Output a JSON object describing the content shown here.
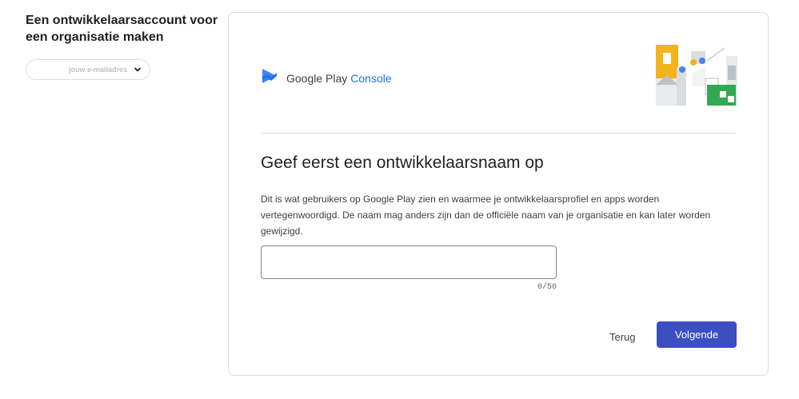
{
  "sidebar": {
    "heading": "Een ontwikkelaarsaccount voor een organisatie maken",
    "account_chip": "jouw e-mailadres",
    "chip_icon": "chevron-down-icon"
  },
  "card": {
    "brand": {
      "name": "Google Play",
      "product": "Console",
      "icon": "google-play-console-logo"
    },
    "title": "Geef eerst een ontwikkelaarsnaam op",
    "description": "Dit is wat gebruikers op Google Play zien en waarmee je ontwikkelaarsprofiel en apps worden vertegenwoordigd. De naam mag anders zijn dan de officiële naam van je organisatie en kan later worden gewijzigd.",
    "input": {
      "value": "",
      "placeholder": ""
    },
    "counter": "0/50",
    "back_label": "Terug",
    "next_label": "Volgende"
  },
  "colors": {
    "primary_button": "#3c4ec0",
    "brand_blue": "#1a73e8",
    "illustration_yellow": "#f2b31c",
    "illustration_green": "#34a853",
    "illustration_blue": "#4285f4"
  }
}
